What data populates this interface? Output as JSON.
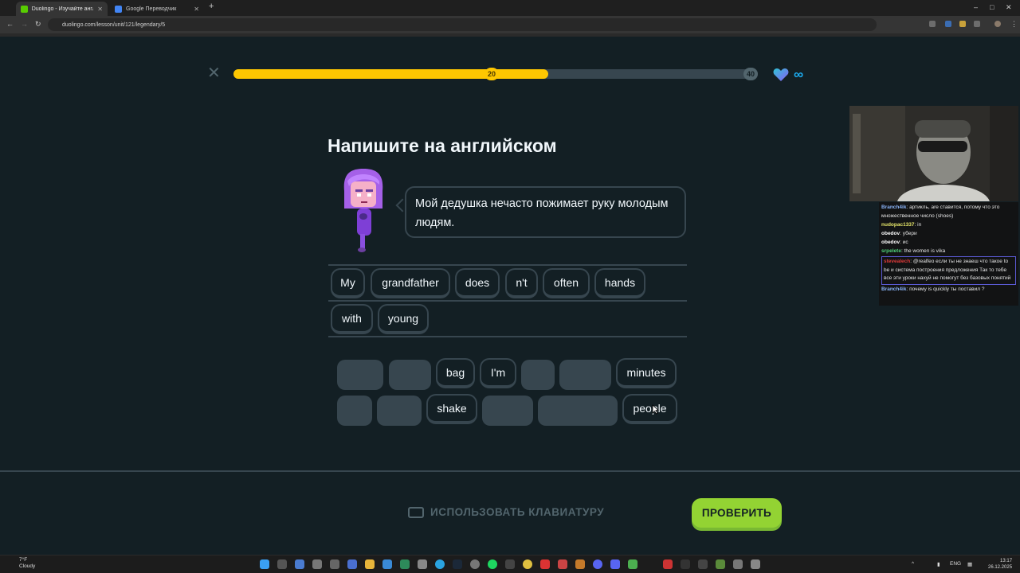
{
  "browser": {
    "tabs": [
      {
        "title": "Duolingo - Изучайте англ",
        "active": true,
        "color": "#58cc02"
      },
      {
        "title": "Google Переводчик",
        "active": false,
        "color": "#4285f4"
      }
    ],
    "url": "duolingo.com/lesson/unit/121/legendary/5"
  },
  "lesson": {
    "progress_fraction": 0.6,
    "marker_current": "20",
    "marker_goal": "40",
    "hearts": "∞",
    "title": "Напишите на английском",
    "prompt": "Мой дедушка нечасто пожимает руку молодым людям."
  },
  "answer_words": [
    "My",
    "grandfather",
    "does",
    "n't",
    "often",
    "hands",
    "with",
    "young"
  ],
  "bank": {
    "visible_words": [
      "bag",
      "I'm",
      "minutes",
      "shake",
      "people"
    ]
  },
  "footer": {
    "keyboard_label": "ИСПОЛЬЗОВАТЬ КЛАВИАТУРУ",
    "check_label": "ПРОВЕРИТЬ"
  },
  "chat": [
    {
      "user": "Branch4ik",
      "color": "#8ab4f8",
      "text": "артикль, are ставится, потому что это множественное число (shoes)"
    },
    {
      "user": "nudopac1337",
      "color": "#e6e66a",
      "text": "in"
    },
    {
      "user": "obedov",
      "color": "#ffffff",
      "text": "убери"
    },
    {
      "user": "obedov",
      "color": "#ffffff",
      "text": "ис"
    },
    {
      "user": "srpelete",
      "color": "#4fd17a",
      "text": "the women is vika"
    },
    {
      "user": "stevealech",
      "color": "#e03a3a",
      "text": "@realfeo если ты не знаеш что такое to be и система построения предложения Так то тебе все эти уроки нахуй не помогут без базовых понятий",
      "highlight": true
    },
    {
      "user": "Branch4ik",
      "color": "#8ab4f8",
      "text": "почему is quickly ты поставил ?"
    }
  ],
  "taskbar": {
    "weather_temp": "7°F",
    "weather_desc": "Cloudy",
    "lang": "ENG",
    "time": "13:17",
    "date": "26.12.2025"
  }
}
